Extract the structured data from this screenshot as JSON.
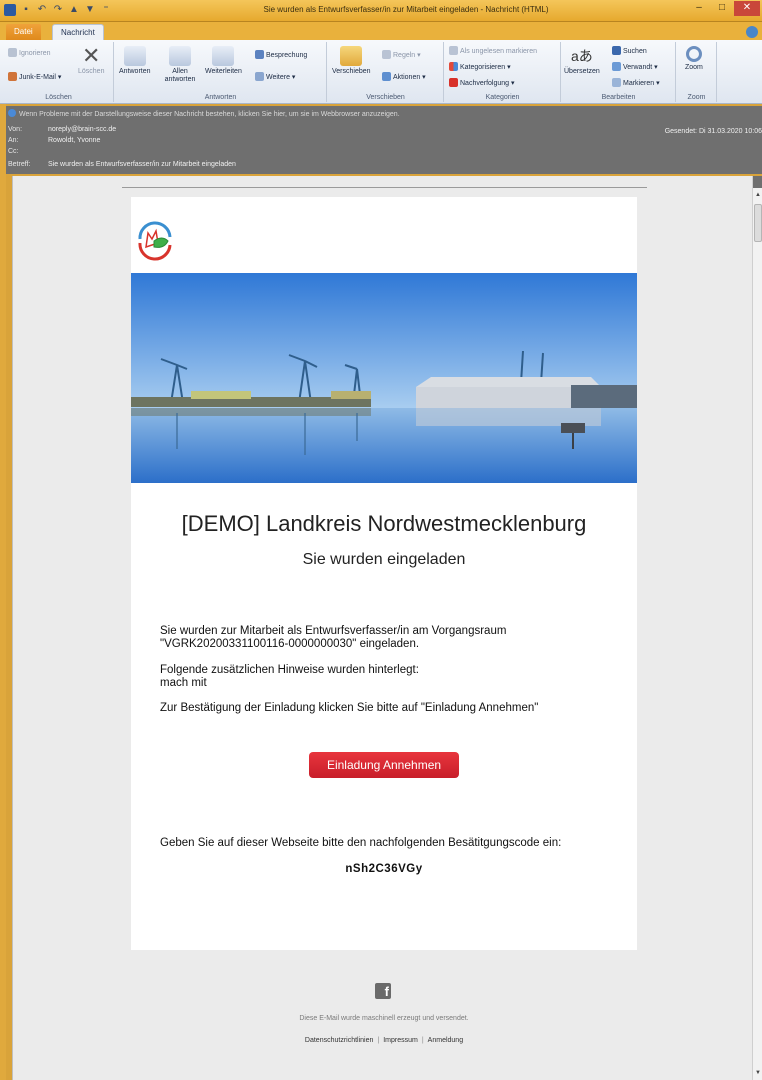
{
  "window": {
    "title": "Sie wurden als Entwurfsverfasser/in zur Mitarbeit eingeladen  -  Nachricht (HTML)",
    "controls": [
      "–",
      "□",
      "✕"
    ]
  },
  "tabs": [
    {
      "label": "Datei"
    },
    {
      "label": "Nachricht"
    }
  ],
  "ribbon": {
    "loeschen": {
      "ignorieren": "Ignorieren",
      "junk": "Junk-E-Mail ▾",
      "loeschen_btn": "Löschen",
      "label": "Löschen"
    },
    "antworten": {
      "antworten": "Antworten",
      "allen": "Allen antworten",
      "weiterleiten": "Weiterleiten",
      "besprechung": "Besprechung",
      "weitere": "Weitere ▾",
      "label": "Antworten"
    },
    "verschieben": {
      "verschieben": "Verschieben",
      "regeln": "Regeln ▾",
      "aktionen": "Aktionen ▾",
      "label": "Verschieben"
    },
    "kategorien": {
      "ungelesen": "Als ungelesen markieren",
      "kategorisieren": "Kategorisieren ▾",
      "nachverfolgung": "Nachverfolgung ▾",
      "label": "Kategorien"
    },
    "bearbeiten": {
      "uebersetzen": "Übersetzen",
      "suchen": "Suchen",
      "verwandt": "Verwandt ▾",
      "markieren": "Markieren ▾",
      "label": "Bearbeiten"
    },
    "zoom": {
      "zoom": "Zoom",
      "label": "Zoom"
    }
  },
  "header": {
    "warning": "Wenn Probleme mit der Darstellungsweise dieser Nachricht bestehen, klicken Sie hier, um sie im Webbrowser anzuzeigen.",
    "von_label": "Von:",
    "von": "noreply@brain-scc.de",
    "an_label": "An:",
    "an": "Rowoldt, Yvonne",
    "cc_label": "Cc:",
    "betreff_label": "Betreff:",
    "betreff": "Sie wurden als Entwurfsverfasser/in zur Mitarbeit eingeladen",
    "gesendet": "Gesendet:  Di 31.03.2020 10:06"
  },
  "email": {
    "org_title": "[DEMO] Landkreis Nordwestmecklenburg",
    "sub_title": "Sie wurden eingeladen",
    "para1": "Sie wurden zur Mitarbeit als Entwurfsverfasser/in am Vorgangsraum \"VGRK20200331100116-0000000030\" eingeladen.",
    "para2_line1": "Folgende zusätzlichen Hinweise wurden hinterlegt:",
    "para2_line2": "mach mit",
    "para3": "Zur Bestätigung der Einladung klicken Sie bitte auf \"Einladung Annehmen\"",
    "accept_button": "Einladung Annehmen",
    "code_intro": "Geben Sie auf dieser Webseite bitte den nachfolgenden Besätitgungscode ein:",
    "code": "nSh2C36VGy"
  },
  "footer": {
    "facebook": "f",
    "note": "Diese E-Mail wurde maschinell erzeugt und versendet.",
    "links": [
      "Datenschutzrichtlinien",
      "Impressum",
      "Anmeldung"
    ],
    "separator": "|"
  }
}
